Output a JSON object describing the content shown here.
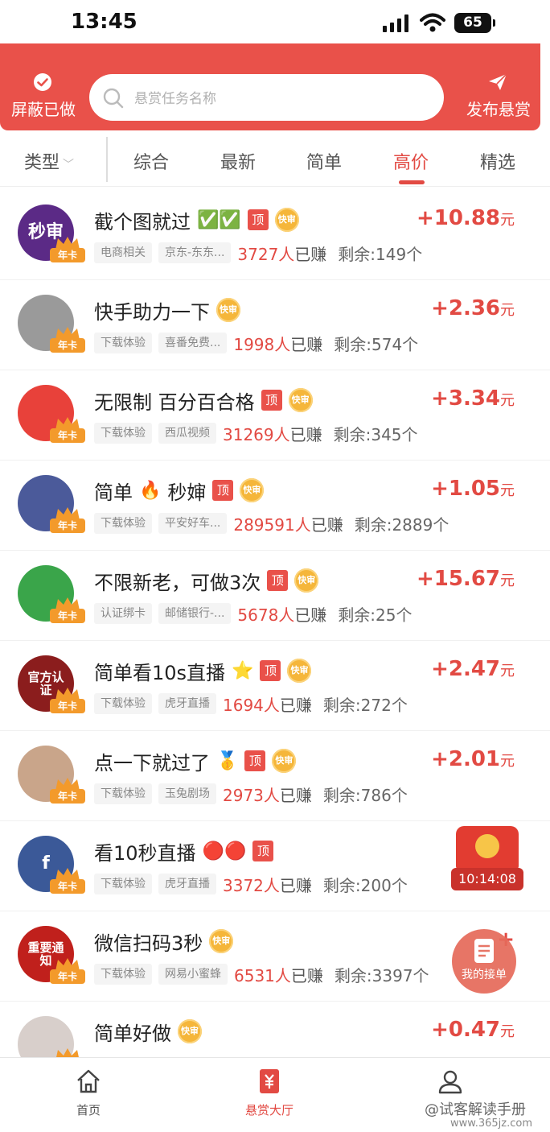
{
  "status_bar": {
    "time": "13:45",
    "battery": "65"
  },
  "header": {
    "left_label": "屏蔽已做",
    "search_placeholder": "悬赏任务名称",
    "right_label": "发布悬赏"
  },
  "filters": {
    "type_label": "类型",
    "tabs": [
      {
        "label": "综合",
        "active": false
      },
      {
        "label": "最新",
        "active": false
      },
      {
        "label": "简单",
        "active": false
      },
      {
        "label": "高价",
        "active": true
      },
      {
        "label": "精选",
        "active": false
      }
    ]
  },
  "tags": {
    "top": "顶",
    "fast": "快审",
    "card": "年卡"
  },
  "tasks": [
    {
      "title": "截个图就过",
      "deco": "✅✅",
      "top": true,
      "fast": true,
      "reward": "+10.88",
      "unit": "元",
      "category": "电商相关",
      "platform": "京东-东东...",
      "earned_count": "3727人",
      "earned_suffix": "已赚",
      "remaining": "剩余:149个",
      "avatar_text": "秒审",
      "avatar_color": "#5b2a86"
    },
    {
      "title": "快手助力一下",
      "deco": "",
      "top": false,
      "fast": true,
      "reward": "+2.36",
      "unit": "元",
      "category": "下载体验",
      "platform": "喜番免费...",
      "earned_count": "1998人",
      "earned_suffix": "已赚",
      "remaining": "剩余:574个",
      "avatar_text": "",
      "avatar_color": "#9a9a9a"
    },
    {
      "title": "无限制 百分百合格",
      "deco": "",
      "top": true,
      "fast": true,
      "reward": "+3.34",
      "unit": "元",
      "category": "下载体验",
      "platform": "西瓜视频",
      "earned_count": "31269人",
      "earned_suffix": "已赚",
      "remaining": "剩余:345个",
      "avatar_text": "",
      "avatar_color": "#e8413a"
    },
    {
      "title": "简单",
      "deco": "🔥",
      "title2": "秒婶",
      "top": true,
      "fast": true,
      "reward": "+1.05",
      "unit": "元",
      "category": "下载体验",
      "platform": "平安好车...",
      "earned_count": "289591人",
      "earned_suffix": "已赚",
      "remaining": "剩余:2889个",
      "avatar_text": "",
      "avatar_color": "#4b5a9a"
    },
    {
      "title": "不限新老，可做3次",
      "deco": "",
      "top": true,
      "fast": true,
      "reward": "+15.67",
      "unit": "元",
      "category": "认证绑卡",
      "platform": "邮储银行-...",
      "earned_count": "5678人",
      "earned_suffix": "已赚",
      "remaining": "剩余:25个",
      "avatar_text": "",
      "avatar_color": "#3aa54a"
    },
    {
      "title": "简单看10s直播",
      "deco": "⭐",
      "top": true,
      "fast": true,
      "reward": "+2.47",
      "unit": "元",
      "category": "下载体验",
      "platform": "虎牙直播",
      "earned_count": "1694人",
      "earned_suffix": "已赚",
      "remaining": "剩余:272个",
      "avatar_text": "官方认证",
      "avatar_color": "#8b1d1d"
    },
    {
      "title": "点一下就过了",
      "deco": "🥇",
      "top": true,
      "fast": true,
      "reward": "+2.01",
      "unit": "元",
      "category": "下载体验",
      "platform": "玉兔剧场",
      "earned_count": "2973人",
      "earned_suffix": "已赚",
      "remaining": "剩余:786个",
      "avatar_text": "",
      "avatar_color": "#c9a58a"
    },
    {
      "title": "看10秒直播",
      "deco": "🔴🔴",
      "top": true,
      "fast": false,
      "reward": "+",
      "unit": "",
      "category": "下载体验",
      "platform": "虎牙直播",
      "earned_count": "3372人",
      "earned_suffix": "已赚",
      "remaining": "剩余:200个",
      "avatar_text": "f",
      "avatar_color": "#3b5998"
    },
    {
      "title": "微信扫码3秒",
      "deco": "",
      "top": false,
      "fast": true,
      "reward": "+",
      "unit": "",
      "category": "下载体验",
      "platform": "网易小蜜蜂",
      "earned_count": "6531人",
      "earned_suffix": "已赚",
      "remaining": "剩余:3397个",
      "avatar_text": "重要通知",
      "avatar_color": "#c0201c"
    },
    {
      "title": "简单好做",
      "deco": "",
      "top": false,
      "fast": true,
      "reward": "+0.47",
      "unit": "元",
      "category": "",
      "platform": "",
      "earned_count": "",
      "earned_suffix": "",
      "remaining": "",
      "avatar_text": "",
      "avatar_color": "#d8cfcb"
    }
  ],
  "floating": {
    "timer": "10:14:08",
    "orders_label": "我的接单"
  },
  "bottom_nav": [
    {
      "label": "首页",
      "icon": "home-icon",
      "active": false
    },
    {
      "label": "悬赏大厅",
      "icon": "reward-hall-icon",
      "active": true
    },
    {
      "label": "我的",
      "icon": "profile-icon",
      "active": false
    }
  ],
  "watermark": {
    "text": "@试客解读手册",
    "url": "www.365jz.com"
  },
  "colors": {
    "brand_red": "#e9514a",
    "accent_red": "#e24a43",
    "crown_orange": "#f39a2b"
  }
}
